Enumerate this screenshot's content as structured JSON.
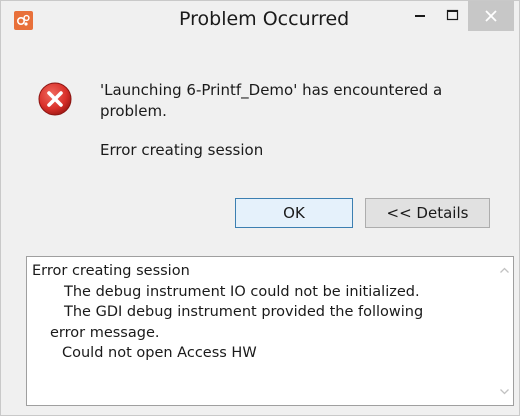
{
  "window": {
    "title": "Problem Occurred",
    "icons": {
      "app": "app-icon",
      "minimize": "minimize-icon",
      "maximize": "maximize-icon",
      "close": "close-icon",
      "error": "error-icon"
    },
    "colors": {
      "close_button_bg": "#c7c7c7",
      "error_red": "#d9302a",
      "app_icon_bg": "#e8703a",
      "ok_button_border": "#3c7fb1"
    }
  },
  "message": {
    "main": "'Launching 6-Printf_Demo' has encountered a problem.",
    "detail": "Error creating session"
  },
  "buttons": {
    "ok_label": "OK",
    "details_label": "<< Details"
  },
  "details": {
    "lines": [
      "Error creating session",
      "The debug instrument IO could not be initialized.",
      "The GDI debug instrument provided the following",
      "error message.",
      "Could not open Access HW"
    ]
  }
}
